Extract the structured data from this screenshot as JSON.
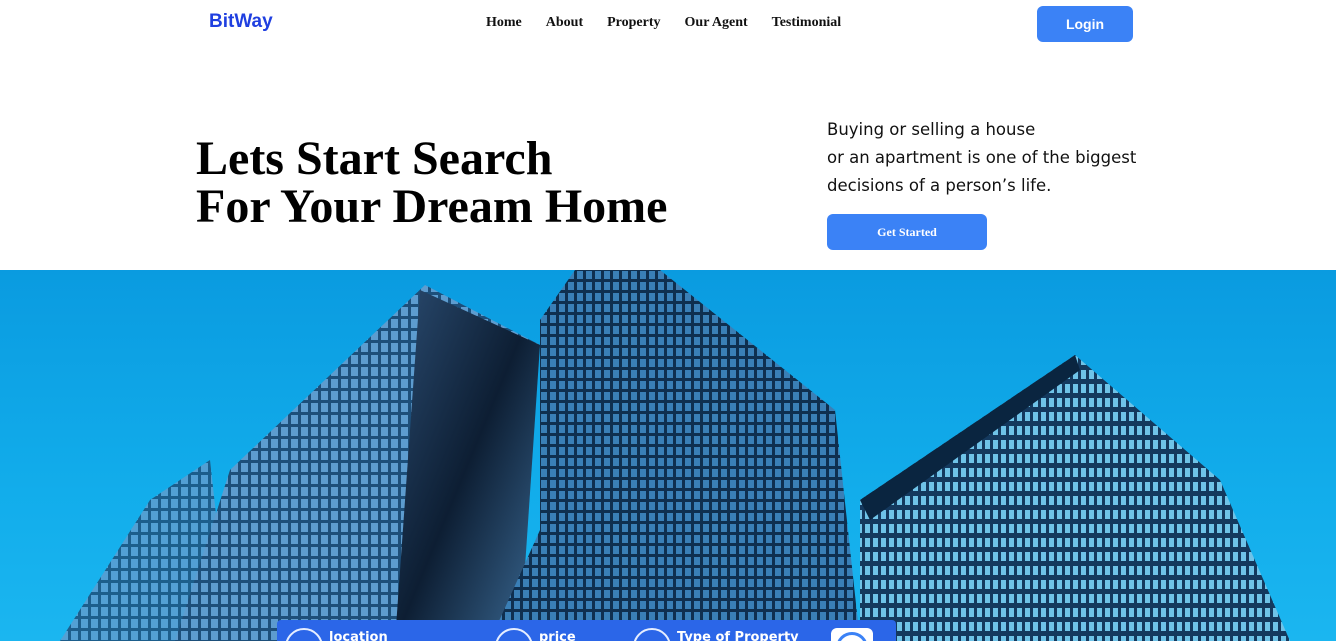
{
  "nav": {
    "brand": "BitWay",
    "links": [
      "Home",
      "About",
      "Property",
      "Our Agent",
      "Testimonial"
    ],
    "login_label": "Login"
  },
  "hero": {
    "title_line1": "Lets Start Search",
    "title_line2": "For Your Dream Home",
    "desc_line1": "Buying or selling a house",
    "desc_line2": "or an apartment is one of the biggest",
    "desc_line3": "decisions of a person’s life.",
    "cta_label": "Get Started"
  },
  "search": {
    "location_label": "location",
    "price_label": "price",
    "type_label": "Type of Property",
    "icons": [
      "location-icon",
      "price-icon",
      "property-type-icon",
      "search-icon"
    ]
  },
  "colors": {
    "brand": "#1f3fe0",
    "accent": "#3b82f6",
    "sky": "#12adeb"
  }
}
